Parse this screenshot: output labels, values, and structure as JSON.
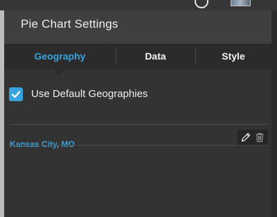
{
  "header": {
    "title": "Pie Chart Settings"
  },
  "tabs": [
    {
      "label": "Geography",
      "active": true
    },
    {
      "label": "Data",
      "active": false
    },
    {
      "label": "Style",
      "active": false
    }
  ],
  "geography": {
    "use_default_label": "Use Default Geographies",
    "use_default_checked": true,
    "items": [
      {
        "label": "Kansas City, MO"
      }
    ]
  },
  "colors": {
    "accent": "#3aa3dc",
    "panel": "#333333",
    "header": "#3f3f3f",
    "tabbar": "#2b2b2b"
  },
  "icons": {
    "topbar": [
      "help-circle-icon",
      "user-avatar-thumbnail"
    ],
    "item_actions": [
      "pencil-icon",
      "trash-icon"
    ],
    "checkbox": "checkmark-icon"
  }
}
